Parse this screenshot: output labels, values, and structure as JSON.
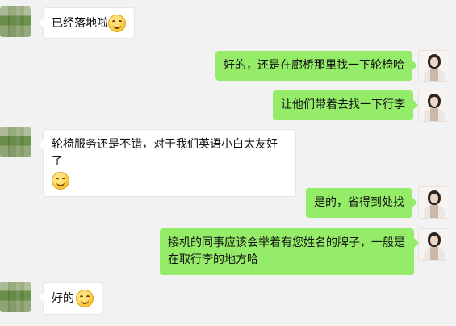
{
  "messages": [
    {
      "side": "left",
      "text": "已经落地啦",
      "emoji": "smile-emoji"
    },
    {
      "side": "right",
      "text": "好的，还是在廊桥那里找一下轮椅哈"
    },
    {
      "side": "right",
      "text": "让他们带着去找一下行李"
    },
    {
      "side": "left",
      "text": "轮椅服务还是不错，对于我们英语小白太友好了",
      "emoji": "smile-emoji"
    },
    {
      "side": "right",
      "text": "是的，省得到处找"
    },
    {
      "side": "right",
      "line1": "接机的同事应该会举着有您姓名的牌子，一般是",
      "line2": "在取行李的地方哈"
    },
    {
      "side": "left",
      "text": "好的",
      "emoji": "smile-emoji"
    }
  ]
}
